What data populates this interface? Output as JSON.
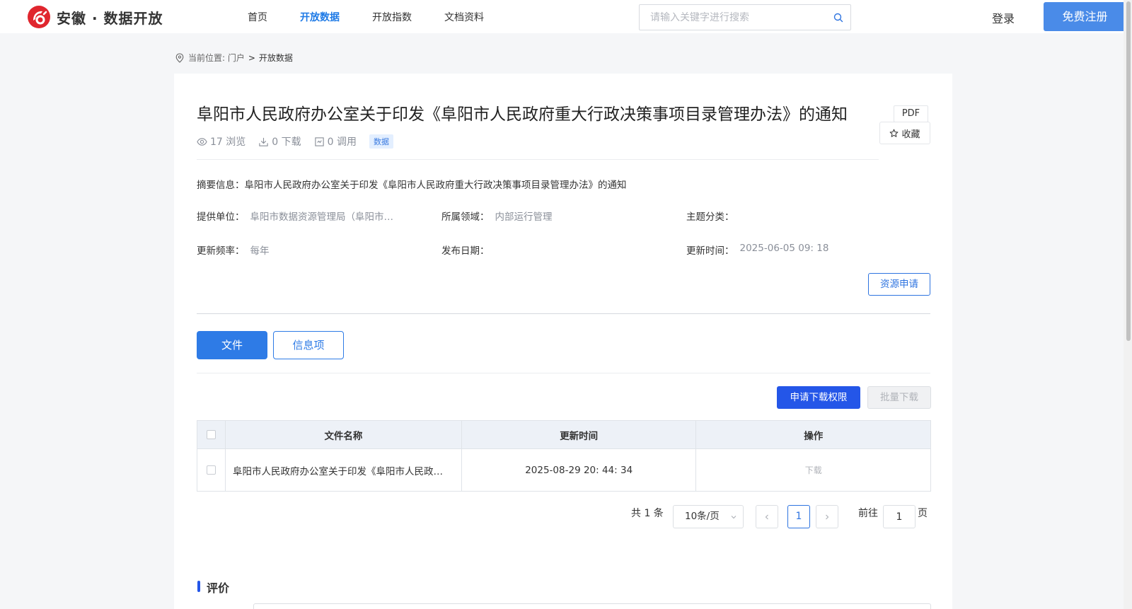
{
  "header": {
    "logo_text": "安徽 · 数据开放",
    "brand_color": "#e0262e",
    "nav": [
      {
        "label": "首页",
        "active": false
      },
      {
        "label": "开放数据",
        "active": true
      },
      {
        "label": "开放指数",
        "active": false
      },
      {
        "label": "文档资料",
        "active": false
      }
    ],
    "search_placeholder": "请输入关键字进行搜索",
    "login_label": "登录",
    "register_label": "免费注册"
  },
  "breadcrumb": {
    "prefix": "当前位置: 门户",
    "separator": ">",
    "current": "开放数据"
  },
  "detail": {
    "title": "阜阳市人民政府办公室关于印发《阜阳市人民政府重大行政决策事项目录管理办法》的通知",
    "format_tag": "PDF",
    "favorite_label": "收藏",
    "stats": {
      "views": "17 浏览",
      "downloads": "0 下载",
      "calls": "0 调用",
      "type_tag": "数据"
    },
    "summary": "摘要信息：阜阳市人民政府办公室关于印发《阜阳市人民政府重大行政决策事项目录管理办法》的通知",
    "meta": {
      "provider_label": "提供单位：",
      "provider_value": "阜阳市数据资源管理局（阜阳市人民政府办公室）",
      "domain_label": "所属领域：",
      "domain_value": "内部运行管理",
      "topic_label": "主题分类：",
      "topic_value": "",
      "frequency_label": "更新频率：",
      "frequency_value": "每年",
      "publish_label": "发布日期：",
      "publish_value": "",
      "updated_label": "更新时间：",
      "updated_value": "2025-06-05 09: 18"
    },
    "apply_label": "资源申请"
  },
  "tabs": [
    {
      "label": "文件",
      "active": true
    },
    {
      "label": "信息项",
      "active": false
    }
  ],
  "actions": {
    "request_download_label": "申请下载权限",
    "batch_download_label": "批量下载"
  },
  "table": {
    "headers": [
      "文件名称",
      "更新时间",
      "操作"
    ],
    "rows": [
      {
        "name": "阜阳市人民政府办公室关于印发《阜阳市人民政府重大行政决策事项目录管理办法》的通知",
        "updated": "2025-08-29 20: 44: 34",
        "action": "下载"
      }
    ]
  },
  "pagination": {
    "total_text": "共 1 条",
    "page_size": "10条/页",
    "current_page": "1",
    "goto_label": "前往",
    "goto_value": "1",
    "page_suffix": "页"
  },
  "evaluation": {
    "title": "评价",
    "accent_color": "#2456e8"
  }
}
